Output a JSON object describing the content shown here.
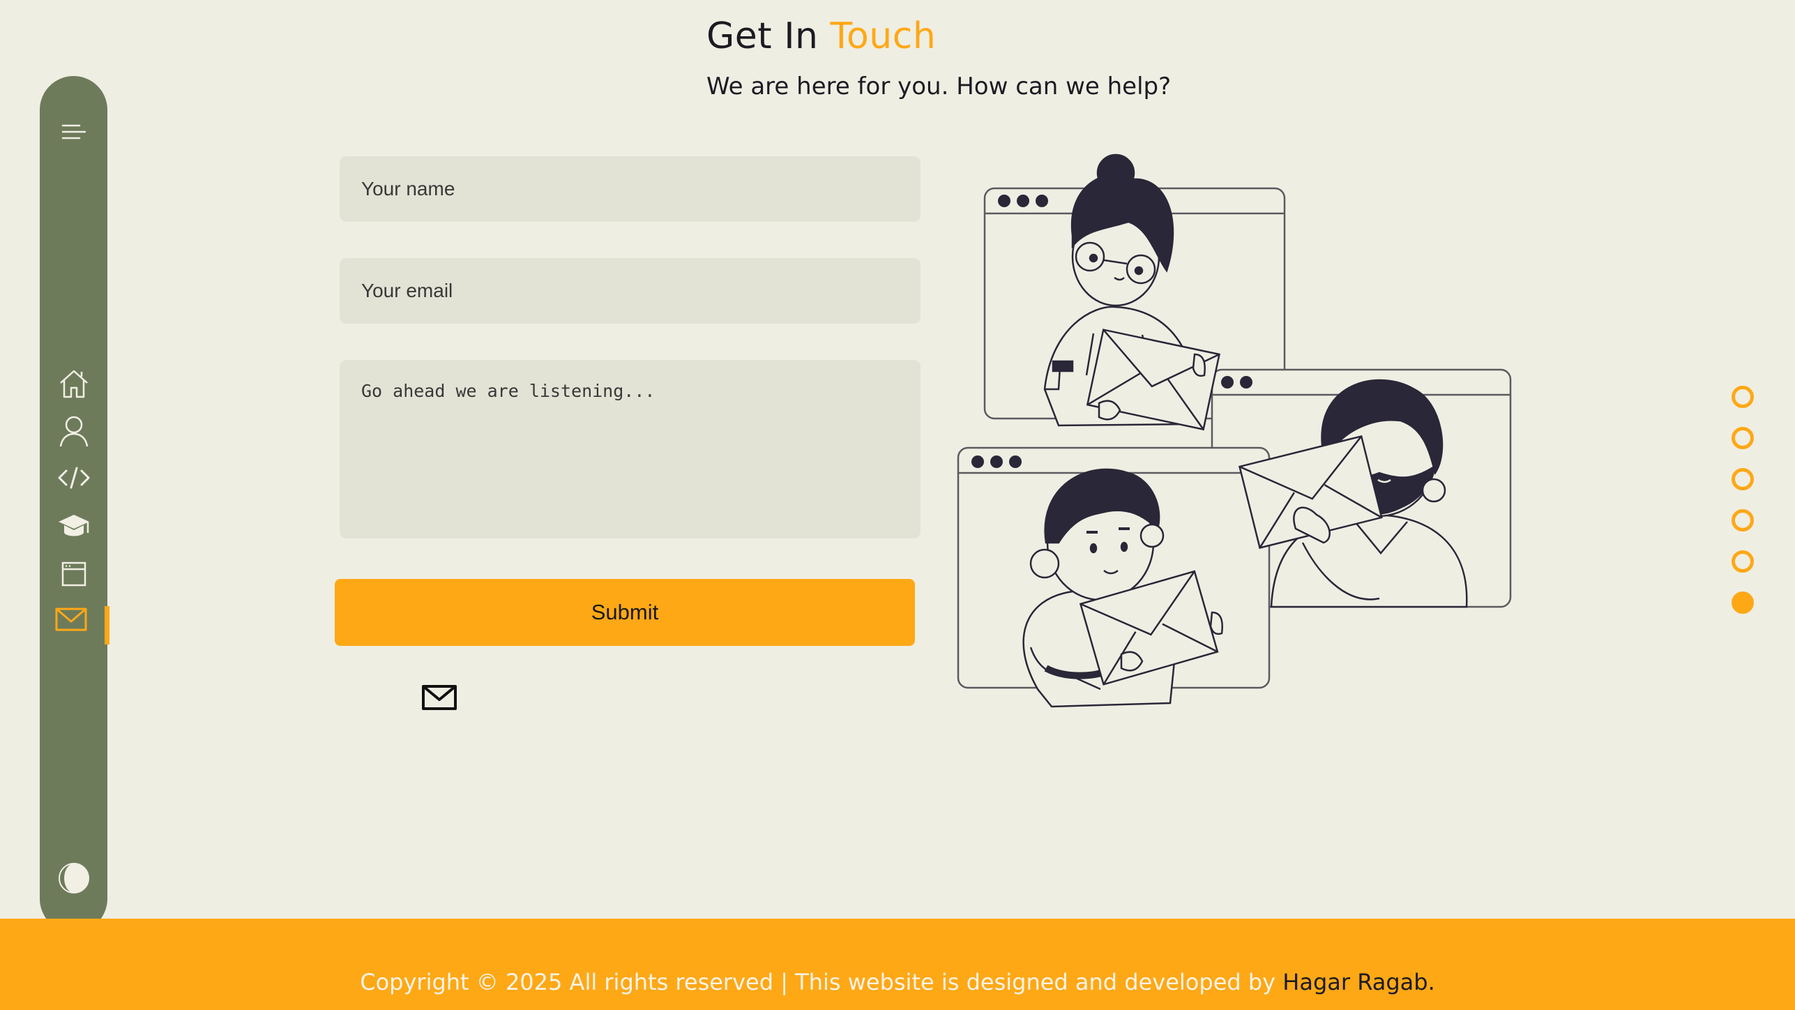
{
  "sidebar": {
    "items": [
      {
        "icon": "menu-icon",
        "label": "Menu"
      },
      {
        "icon": "home-icon",
        "label": "Home"
      },
      {
        "icon": "user-icon",
        "label": "About"
      },
      {
        "icon": "code-icon",
        "label": "Skills"
      },
      {
        "icon": "graduation-cap-icon",
        "label": "Education"
      },
      {
        "icon": "browser-window-icon",
        "label": "Projects"
      },
      {
        "icon": "mail-icon",
        "label": "Contact",
        "active": true
      },
      {
        "icon": "theme-toggle-icon",
        "label": "Theme"
      }
    ]
  },
  "contact": {
    "title_main": "Get In ",
    "title_accent": "Touch",
    "subtitle": "We are here for you. How can we help?",
    "name_placeholder": "Your name",
    "email_placeholder": "Your email",
    "message_placeholder": "Go ahead we are listening...",
    "submit_label": "Submit"
  },
  "section_dots": {
    "count": 6,
    "active_index": 5
  },
  "footer": {
    "copyright": "Copyright © 2025 All rights reserved | This website is designed and developed by ",
    "author": "Hagar Ragab."
  },
  "colors": {
    "background": "#efeee3",
    "accent": "#fea816",
    "sidebar": "#6d7b5b",
    "field": "#e2e3d5",
    "text": "#1c1b22"
  }
}
